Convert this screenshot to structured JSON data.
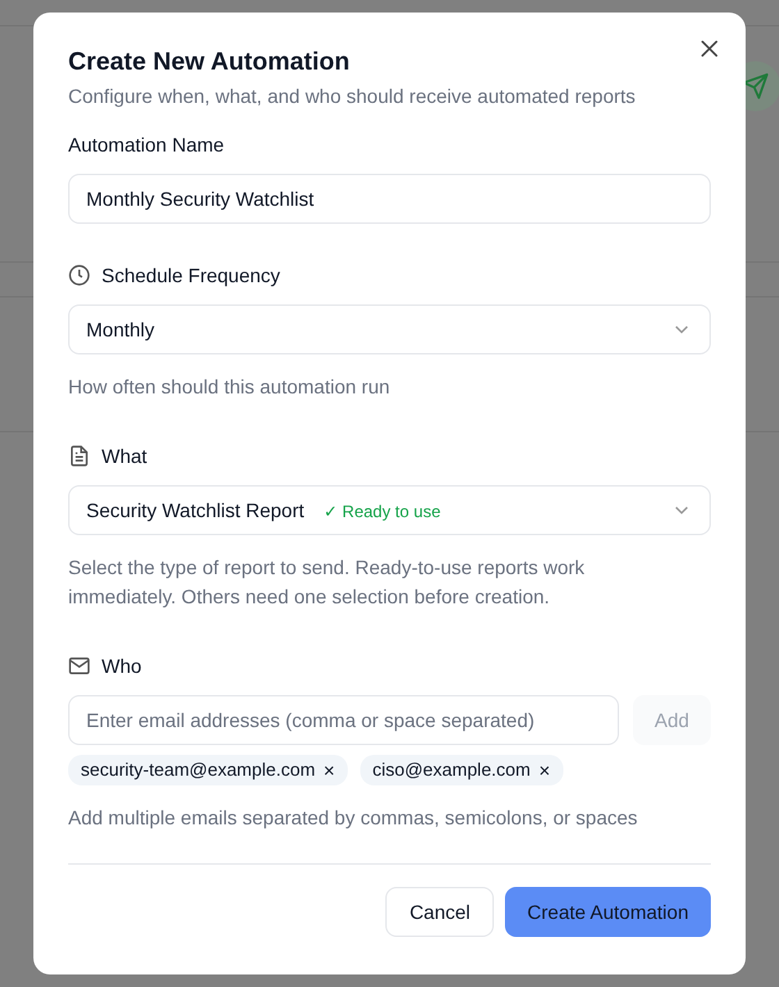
{
  "dialog": {
    "title": "Create New Automation",
    "subtitle": "Configure when, what, and who should receive automated reports"
  },
  "name_field": {
    "label": "Automation Name",
    "value": "Monthly Security Watchlist"
  },
  "schedule": {
    "label": "Schedule Frequency",
    "value": "Monthly",
    "hint": "How often should this automation run"
  },
  "what": {
    "label": "What",
    "value": "Security Watchlist Report",
    "badge": "✓ Ready to use",
    "hint": "Select the type of report to send. Ready-to-use reports work immediately. Others need one selection before creation."
  },
  "who": {
    "label": "Who",
    "placeholder": "Enter email addresses (comma or space separated)",
    "add_button": "Add",
    "recipients": [
      {
        "email": "security-team@example.com",
        "remove": "×"
      },
      {
        "email": "ciso@example.com",
        "remove": "×"
      }
    ],
    "hint": "Add multiple emails separated by commas, semicolons, or spaces"
  },
  "buttons": [
    {
      "label": "Cancel",
      "kind": "secondary"
    },
    {
      "label": "Create Automation",
      "kind": "primary"
    }
  ]
}
